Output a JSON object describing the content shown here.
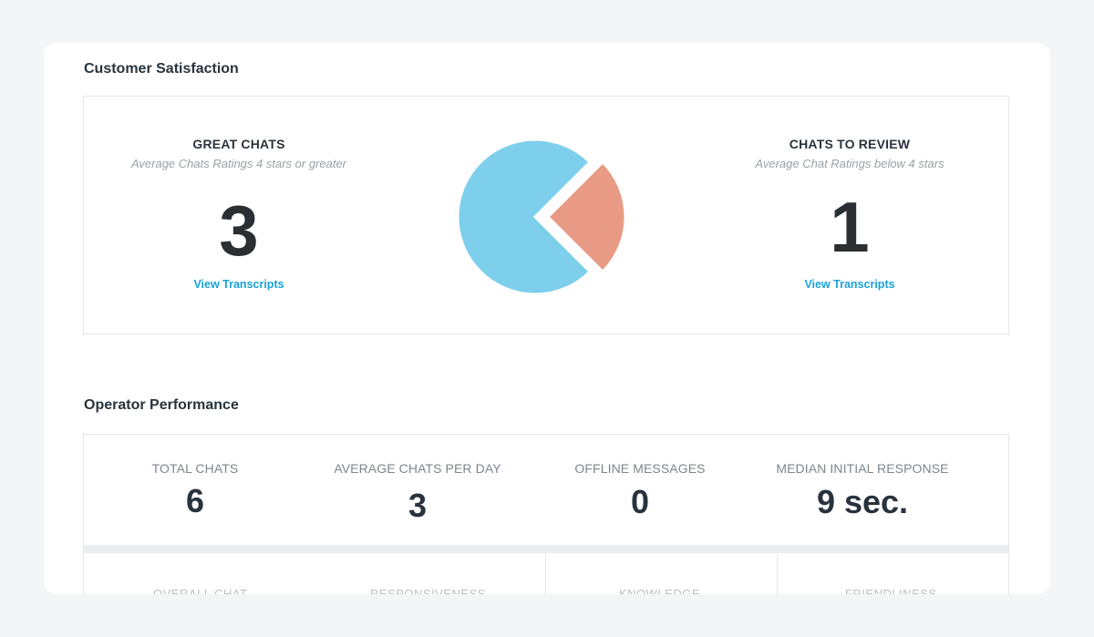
{
  "customer_satisfaction": {
    "title": "Customer Satisfaction",
    "great_chats": {
      "heading": "GREAT CHATS",
      "subtitle": "Average Chats Ratings 4 stars or greater",
      "count": "3",
      "link": "View Transcripts"
    },
    "chats_to_review": {
      "heading": "CHATS TO REVIEW",
      "subtitle": "Average Chat Ratings below 4 stars",
      "count": "1",
      "link": "View Transcripts"
    },
    "pie": {
      "colors": {
        "great": "#7ecfeb",
        "review": "#e99a84"
      }
    }
  },
  "chart_data": {
    "type": "pie",
    "slices": [
      {
        "value": 3,
        "color": "#7ecfeb"
      },
      {
        "value": 1,
        "color": "#e99a84"
      }
    ]
  },
  "operator_performance": {
    "title": "Operator Performance",
    "metrics": [
      {
        "label": "TOTAL CHATS",
        "value": "6"
      },
      {
        "label": "AVERAGE CHATS PER DAY",
        "value": "3"
      },
      {
        "label": "OFFLINE MESSAGES",
        "value": "0"
      },
      {
        "label": "MEDIAN INITIAL RESPONSE",
        "value": "9 sec."
      }
    ],
    "lower_labels": [
      "OVERALL CHAT",
      "RESPONSIVENESS",
      "KNOWLEDGE",
      "FRIENDLINESS"
    ]
  }
}
